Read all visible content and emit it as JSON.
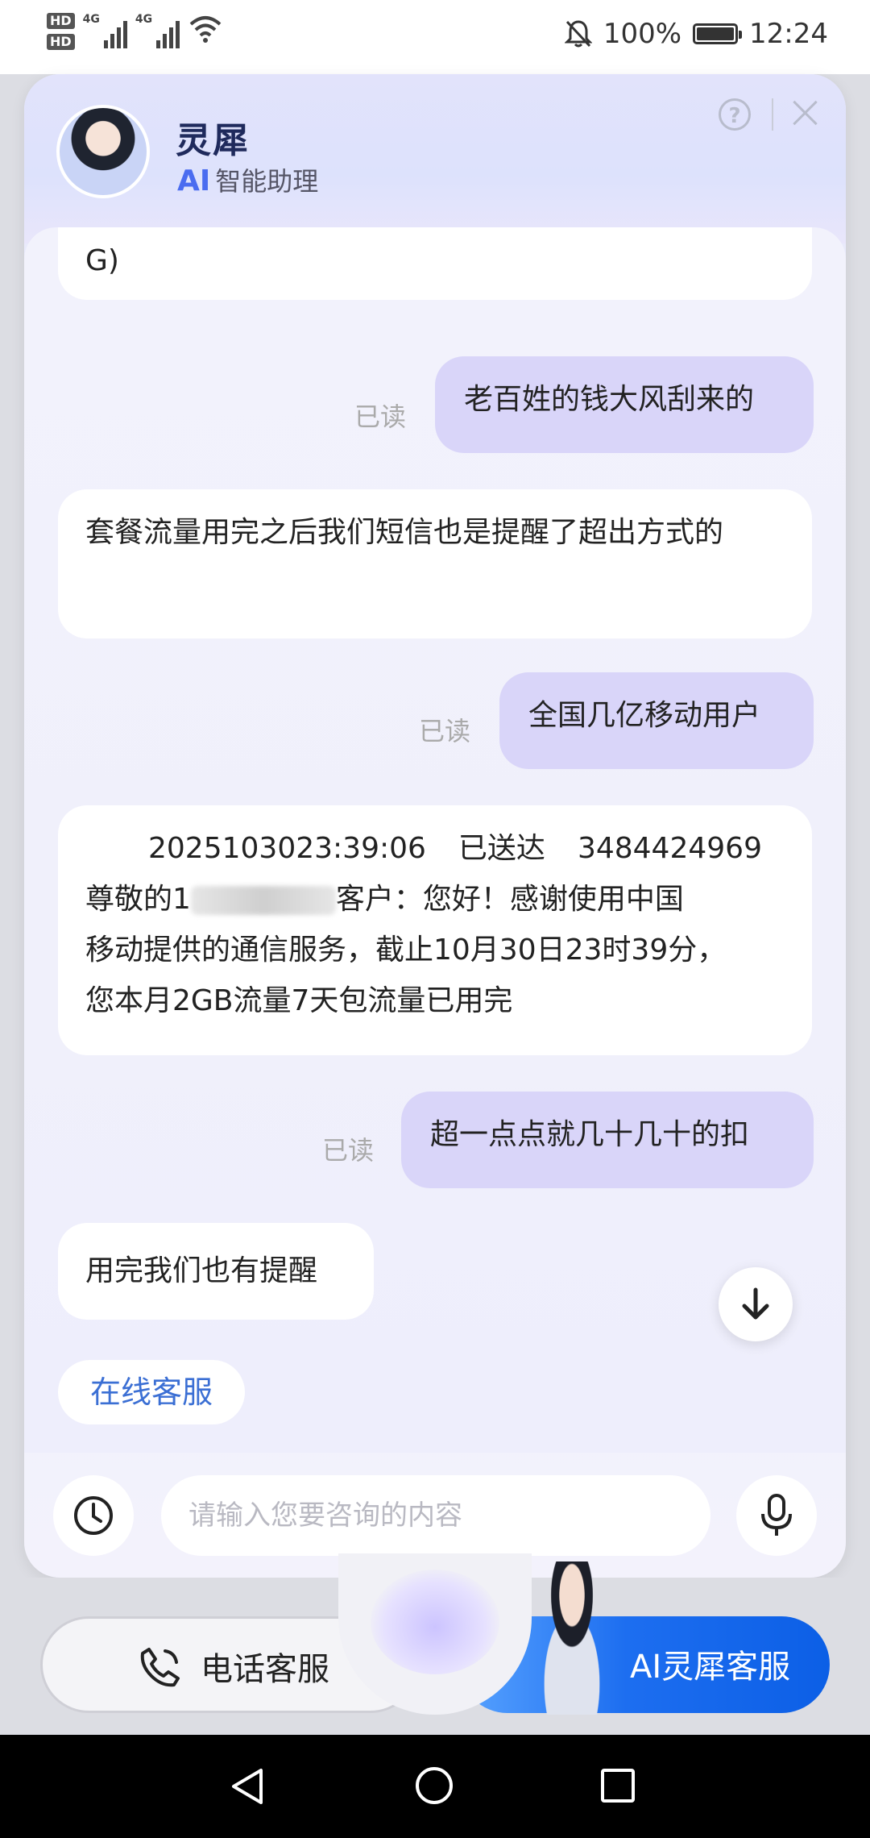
{
  "status": {
    "network1": "4G",
    "network2": "4G",
    "battery": "100%",
    "time": "12:24",
    "sim1": "HD",
    "sim2": "HD"
  },
  "header": {
    "name": "灵犀",
    "ai_tag": "AI",
    "subtitle": "智能助理",
    "help": "?"
  },
  "messages": [
    {
      "type": "in",
      "text": "G)"
    },
    {
      "type": "out",
      "text": "老百姓的钱大风刮来的",
      "status": "已读"
    },
    {
      "type": "in",
      "text": "套餐流量用完之后我们短信也是提醒了超出方式的"
    },
    {
      "type": "out",
      "text": "全国几亿移动用户",
      "status": "已读"
    },
    {
      "type": "in",
      "line1": "2025103023:39:06",
      "line1b": "已送达",
      "line1c": "3484424969",
      "line2a": "尊敬的1",
      "line2b": "客户：您好！感谢使用中国",
      "line3": "移动提供的通信服务，截止10月30日23时39分，",
      "line4": "您本月2GB流量7天包流量已用完"
    },
    {
      "type": "out",
      "text": "超一点点就几十几十的扣",
      "status": "已读"
    },
    {
      "type": "in",
      "text": "用完我们也有提醒"
    }
  ],
  "quick_reply": "在线客服",
  "input": {
    "placeholder": "请输入您要咨询的内容"
  },
  "dock": {
    "phone_label": "电话客服",
    "ai_label": "AI灵犀客服"
  }
}
